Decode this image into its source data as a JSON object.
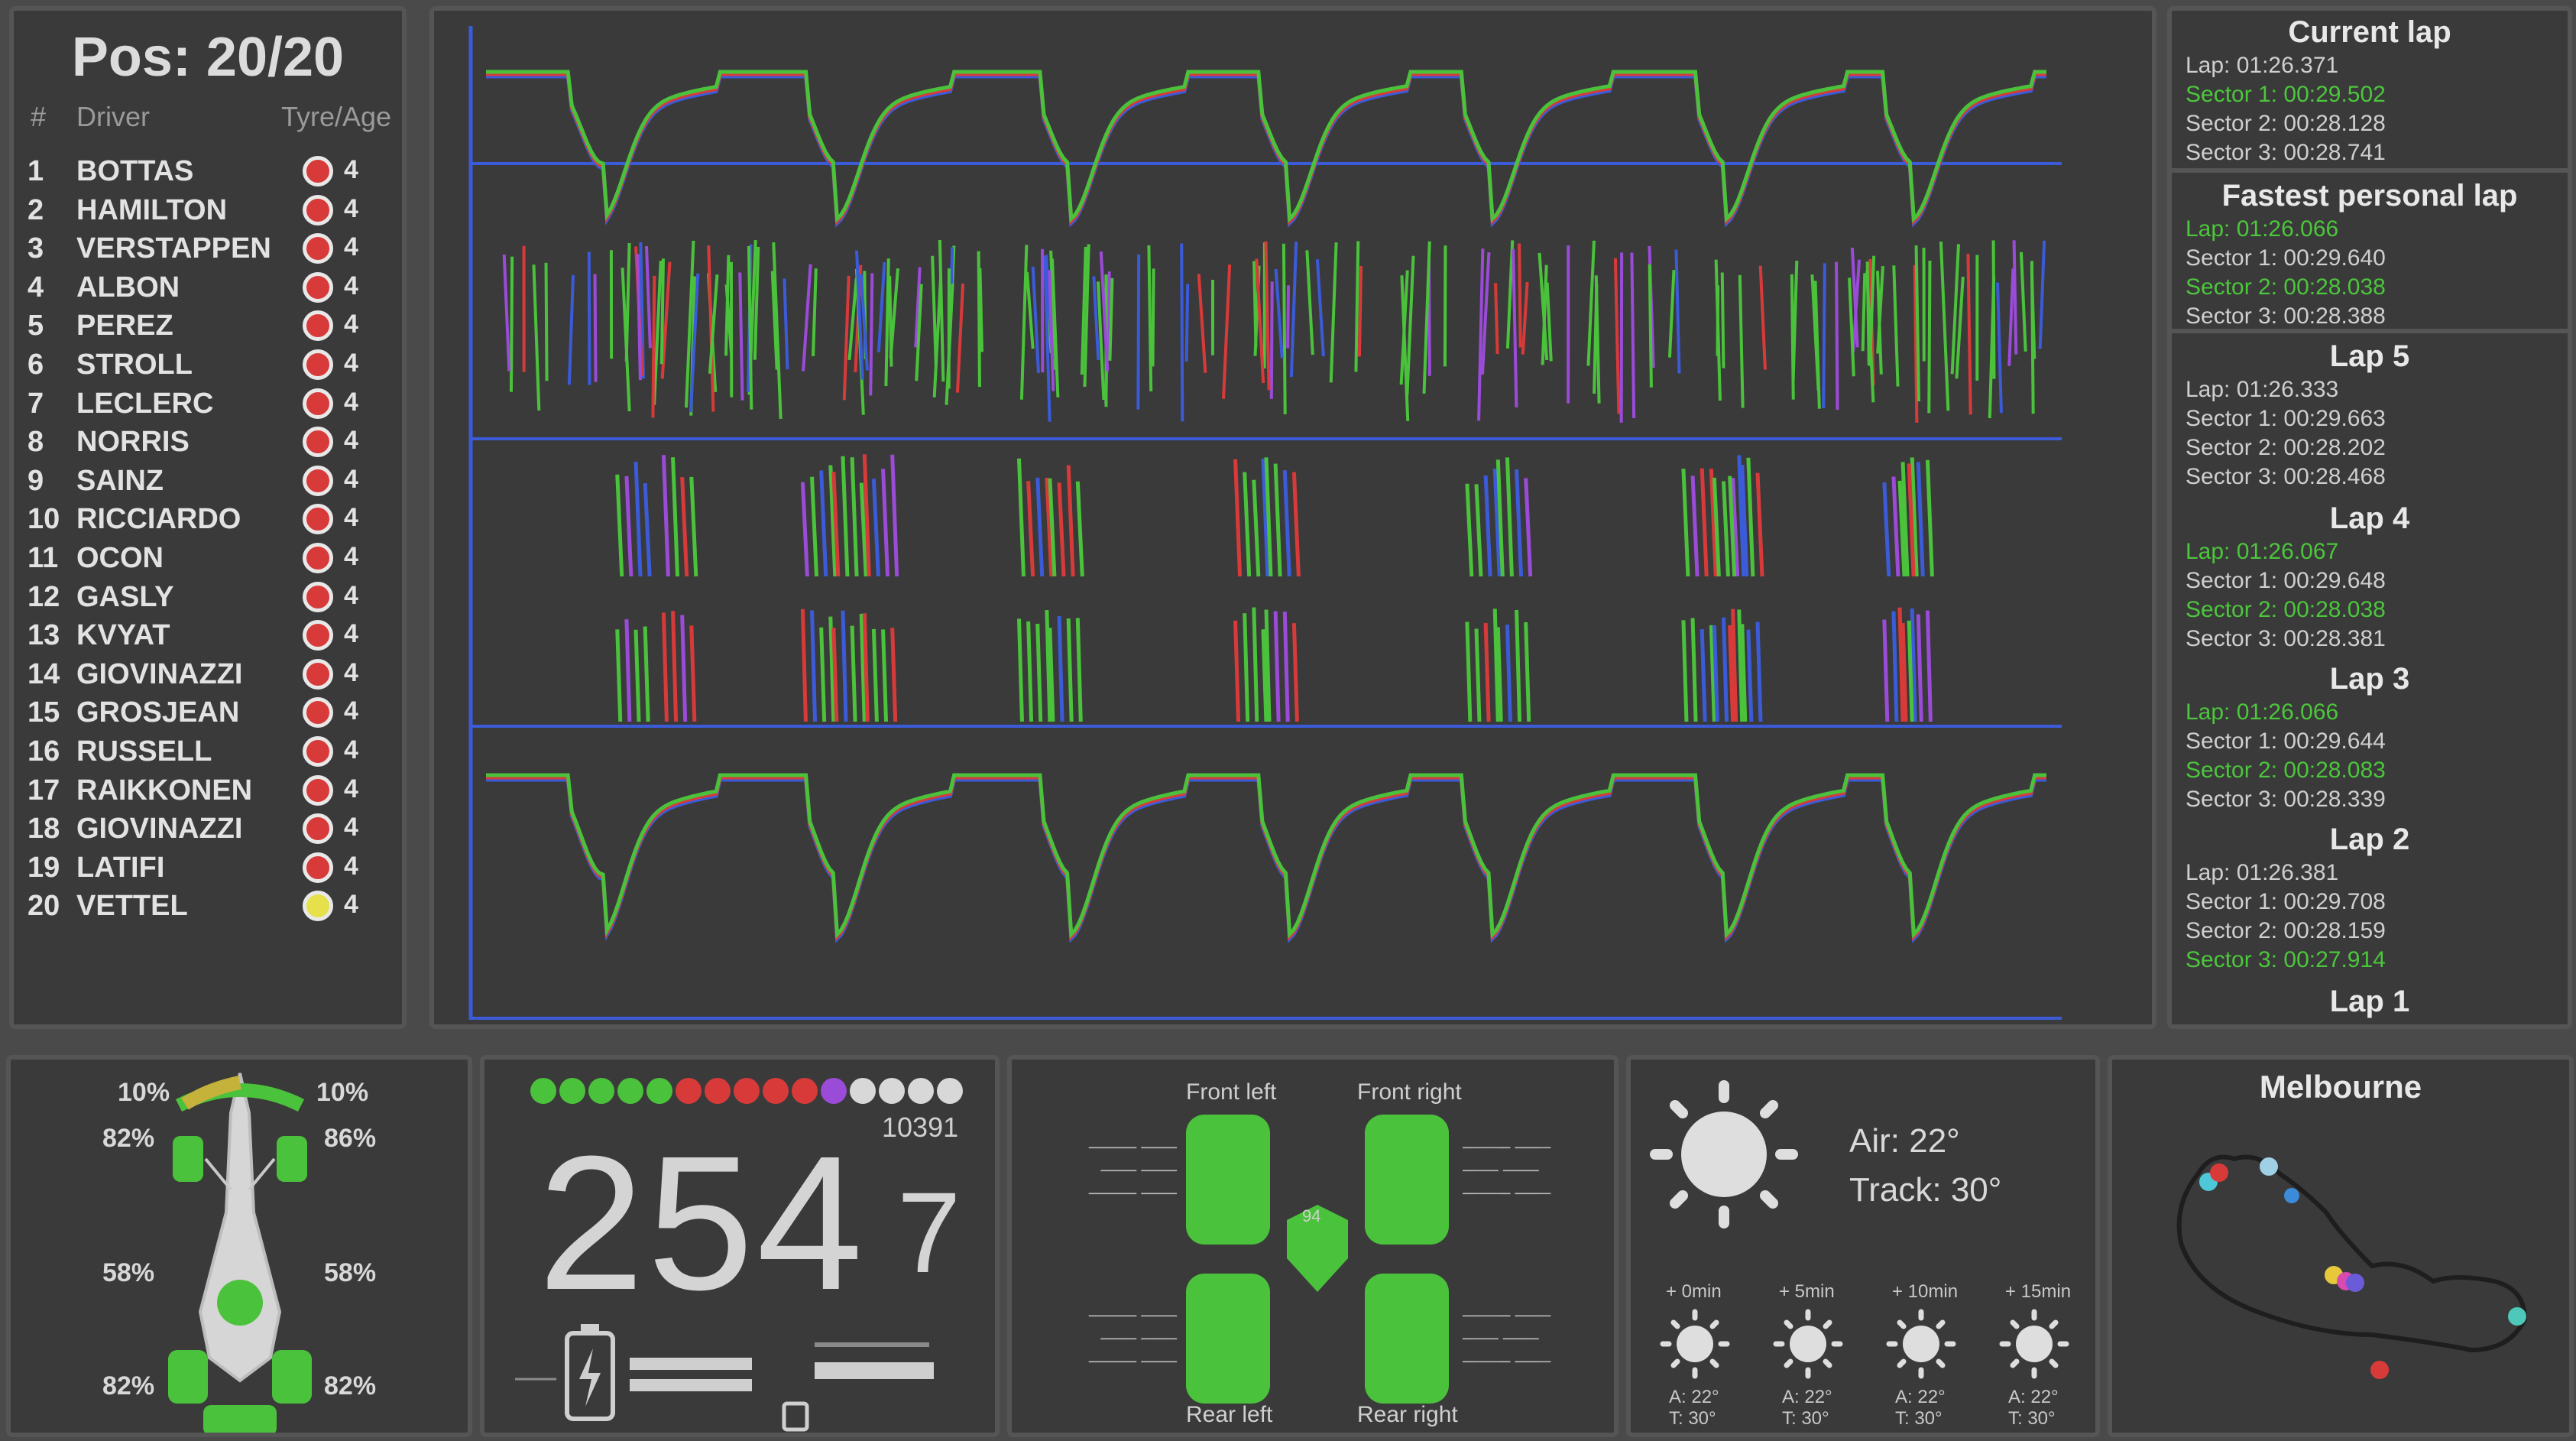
{
  "positions": {
    "title": "Pos: 20/20",
    "headers": {
      "pos": "#",
      "driver": "Driver",
      "tyre": "Tyre/Age"
    },
    "rows": [
      {
        "pos": "1",
        "driver": "BOTTAS",
        "tyre_color": "#d83a3a",
        "age": "4"
      },
      {
        "pos": "2",
        "driver": "HAMILTON",
        "tyre_color": "#d83a3a",
        "age": "4"
      },
      {
        "pos": "3",
        "driver": "VERSTAPPEN",
        "tyre_color": "#d83a3a",
        "age": "4"
      },
      {
        "pos": "4",
        "driver": "ALBON",
        "tyre_color": "#d83a3a",
        "age": "4"
      },
      {
        "pos": "5",
        "driver": "PEREZ",
        "tyre_color": "#d83a3a",
        "age": "4"
      },
      {
        "pos": "6",
        "driver": "STROLL",
        "tyre_color": "#d83a3a",
        "age": "4"
      },
      {
        "pos": "7",
        "driver": "LECLERC",
        "tyre_color": "#d83a3a",
        "age": "4"
      },
      {
        "pos": "8",
        "driver": "NORRIS",
        "tyre_color": "#d83a3a",
        "age": "4"
      },
      {
        "pos": "9",
        "driver": "SAINZ",
        "tyre_color": "#d83a3a",
        "age": "4"
      },
      {
        "pos": "10",
        "driver": "RICCIARDO",
        "tyre_color": "#d83a3a",
        "age": "4"
      },
      {
        "pos": "11",
        "driver": "OCON",
        "tyre_color": "#d83a3a",
        "age": "4"
      },
      {
        "pos": "12",
        "driver": "GASLY",
        "tyre_color": "#d83a3a",
        "age": "4"
      },
      {
        "pos": "13",
        "driver": "KVYAT",
        "tyre_color": "#d83a3a",
        "age": "4"
      },
      {
        "pos": "14",
        "driver": "GIOVINAZZI",
        "tyre_color": "#d83a3a",
        "age": "4"
      },
      {
        "pos": "15",
        "driver": "GROSJEAN",
        "tyre_color": "#d83a3a",
        "age": "4"
      },
      {
        "pos": "16",
        "driver": "RUSSELL",
        "tyre_color": "#d83a3a",
        "age": "4"
      },
      {
        "pos": "17",
        "driver": "RAIKKONEN",
        "tyre_color": "#d83a3a",
        "age": "4"
      },
      {
        "pos": "18",
        "driver": "GIOVINAZZI",
        "tyre_color": "#d83a3a",
        "age": "4"
      },
      {
        "pos": "19",
        "driver": "LATIFI",
        "tyre_color": "#d83a3a",
        "age": "4"
      },
      {
        "pos": "20",
        "driver": "VETTEL",
        "tyre_color": "#e6e14a",
        "age": "4"
      }
    ]
  },
  "laps": {
    "blocks": [
      {
        "title": "Current lap",
        "lines": [
          {
            "text": "Lap: 01:26.371",
            "green": false
          },
          {
            "text": "Sector 1: 00:29.502",
            "green": true
          },
          {
            "text": "Sector 2: 00:28.128",
            "green": false
          },
          {
            "text": "Sector 3: 00:28.741",
            "green": false
          }
        ]
      },
      {
        "title": "Fastest personal lap",
        "lines": [
          {
            "text": "Lap: 01:26.066",
            "green": true
          },
          {
            "text": "Sector 1: 00:29.640",
            "green": false
          },
          {
            "text": "Sector 2: 00:28.038",
            "green": true
          },
          {
            "text": "Sector 3: 00:28.388",
            "green": false
          }
        ]
      },
      {
        "title": "Lap 5",
        "lines": [
          {
            "text": "Lap: 01:26.333",
            "green": false
          },
          {
            "text": "Sector 1: 00:29.663",
            "green": false
          },
          {
            "text": "Sector 2: 00:28.202",
            "green": false
          },
          {
            "text": "Sector 3: 00:28.468",
            "green": false
          }
        ]
      },
      {
        "title": "Lap 4",
        "lines": [
          {
            "text": "Lap: 01:26.067",
            "green": true
          },
          {
            "text": "Sector 1: 00:29.648",
            "green": false
          },
          {
            "text": "Sector 2: 00:28.038",
            "green": true
          },
          {
            "text": "Sector 3: 00:28.381",
            "green": false
          }
        ]
      },
      {
        "title": "Lap 3",
        "lines": [
          {
            "text": "Lap: 01:26.066",
            "green": true
          },
          {
            "text": "Sector 1: 00:29.644",
            "green": false
          },
          {
            "text": "Sector 2: 00:28.083",
            "green": true
          },
          {
            "text": "Sector 3: 00:28.339",
            "green": false
          }
        ]
      },
      {
        "title": "Lap 2",
        "lines": [
          {
            "text": "Lap: 01:26.381",
            "green": false
          },
          {
            "text": "Sector 1: 00:29.708",
            "green": false
          },
          {
            "text": "Sector 2: 00:28.159",
            "green": false
          },
          {
            "text": "Sector 3: 00:27.914",
            "green": true
          }
        ]
      },
      {
        "title": "Lap 1",
        "lines": []
      }
    ]
  },
  "damage": {
    "front_wing_left": "10%",
    "front_wing_right": "10%",
    "tyre_fl": "82%",
    "tyre_fr": "86%",
    "mid_left": "58%",
    "mid_right": "58%",
    "tyre_rl": "82%",
    "tyre_rr": "82%"
  },
  "speed": {
    "value": "254",
    "gear": "7",
    "rpm": "10391"
  },
  "rev_lights": [
    "#4bc23b",
    "#4bc23b",
    "#4bc23b",
    "#4bc23b",
    "#4bc23b",
    "#d83a3a",
    "#d83a3a",
    "#d83a3a",
    "#d83a3a",
    "#d83a3a",
    "#9a4bd8",
    "#d8d8d8",
    "#d8d8d8",
    "#d8d8d8",
    "#d8d8d8"
  ],
  "tyres": {
    "fl_label": "Front left",
    "fr_label": "Front right",
    "rl_label": "Rear left",
    "rr_label": "Rear right",
    "brake_temp": "94"
  },
  "weather": {
    "air": "Air: 22°",
    "track": "Track: 30°",
    "forecast": [
      {
        "time": "+ 0min",
        "air": "A: 22°",
        "track": "T: 30°"
      },
      {
        "time": "+ 5min",
        "air": "A: 22°",
        "track": "T: 30°"
      },
      {
        "time": "+ 10min",
        "air": "A: 22°",
        "track": "T: 30°"
      },
      {
        "time": "+ 15min",
        "air": "A: 22°",
        "track": "T: 30°"
      }
    ]
  },
  "track": {
    "name": "Melbourne"
  },
  "colors": {
    "green": "#4bc23b",
    "red": "#d83a3a",
    "blue": "#3b5bd8",
    "purple": "#9a4bd8",
    "yellow": "#e6e14a"
  }
}
